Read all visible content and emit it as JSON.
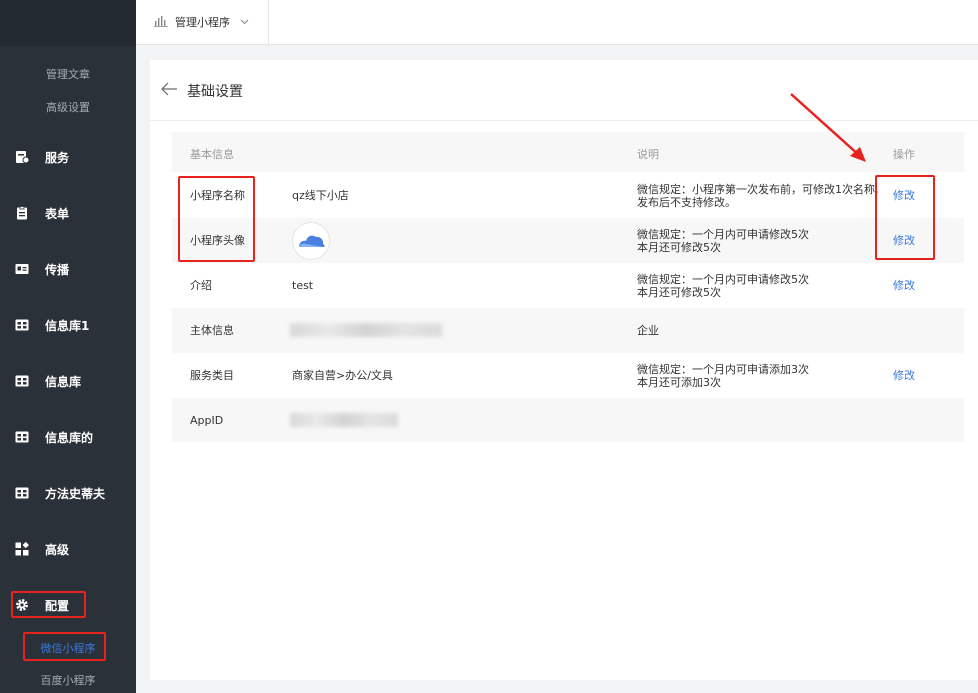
{
  "sidebar": {
    "sub_items_top": [
      "管理文章",
      "高级设置"
    ],
    "items": [
      {
        "label": "服务",
        "icon": "service-icon"
      },
      {
        "label": "表单",
        "icon": "form-icon"
      },
      {
        "label": "传播",
        "icon": "id-card-icon"
      },
      {
        "label": "信息库1",
        "icon": "grid-icon"
      },
      {
        "label": "信息库",
        "icon": "grid-icon"
      },
      {
        "label": "信息库的",
        "icon": "grid-icon"
      },
      {
        "label": "方法史蒂夫",
        "icon": "grid-icon"
      },
      {
        "label": "高级",
        "icon": "apps-icon"
      },
      {
        "label": "配置",
        "icon": "gear-icon"
      }
    ],
    "sub_items_bottom": [
      "微信小程序",
      "百度小程序"
    ]
  },
  "topbar": {
    "app_name": "管理小程序"
  },
  "panel": {
    "title": "基础设置",
    "table": {
      "headers": {
        "info": "基本信息",
        "desc": "说明",
        "action": "操作"
      },
      "rows": [
        {
          "label": "小程序名称",
          "value": "qz线下小店",
          "desc1": "微信规定：小程序第一次发布前，可修改1次名称,",
          "desc2": "发布后不支持修改。",
          "action": "修改"
        },
        {
          "label": "小程序头像",
          "value": "",
          "desc1": "微信规定：一个月内可申请修改5次",
          "desc2": "本月还可修改5次",
          "action": "修改"
        },
        {
          "label": "介绍",
          "value": "test",
          "desc1": "微信规定：一个月内可申请修改5次",
          "desc2": "本月还可修改5次",
          "action": "修改"
        },
        {
          "label": "主体信息",
          "value": "",
          "desc1": "企业",
          "desc2": "",
          "action": ""
        },
        {
          "label": "服务类目",
          "value": "商家自营>办公/文具",
          "desc1": "微信规定：一个月内可申请添加3次",
          "desc2": "本月还可添加3次",
          "action": "修改"
        },
        {
          "label": "AppID",
          "value": "",
          "desc1": "",
          "desc2": "",
          "action": ""
        }
      ]
    }
  },
  "colors": {
    "sidebar": "#2b3138",
    "accent": "#3c78d8",
    "annotation": "#e8231d"
  }
}
